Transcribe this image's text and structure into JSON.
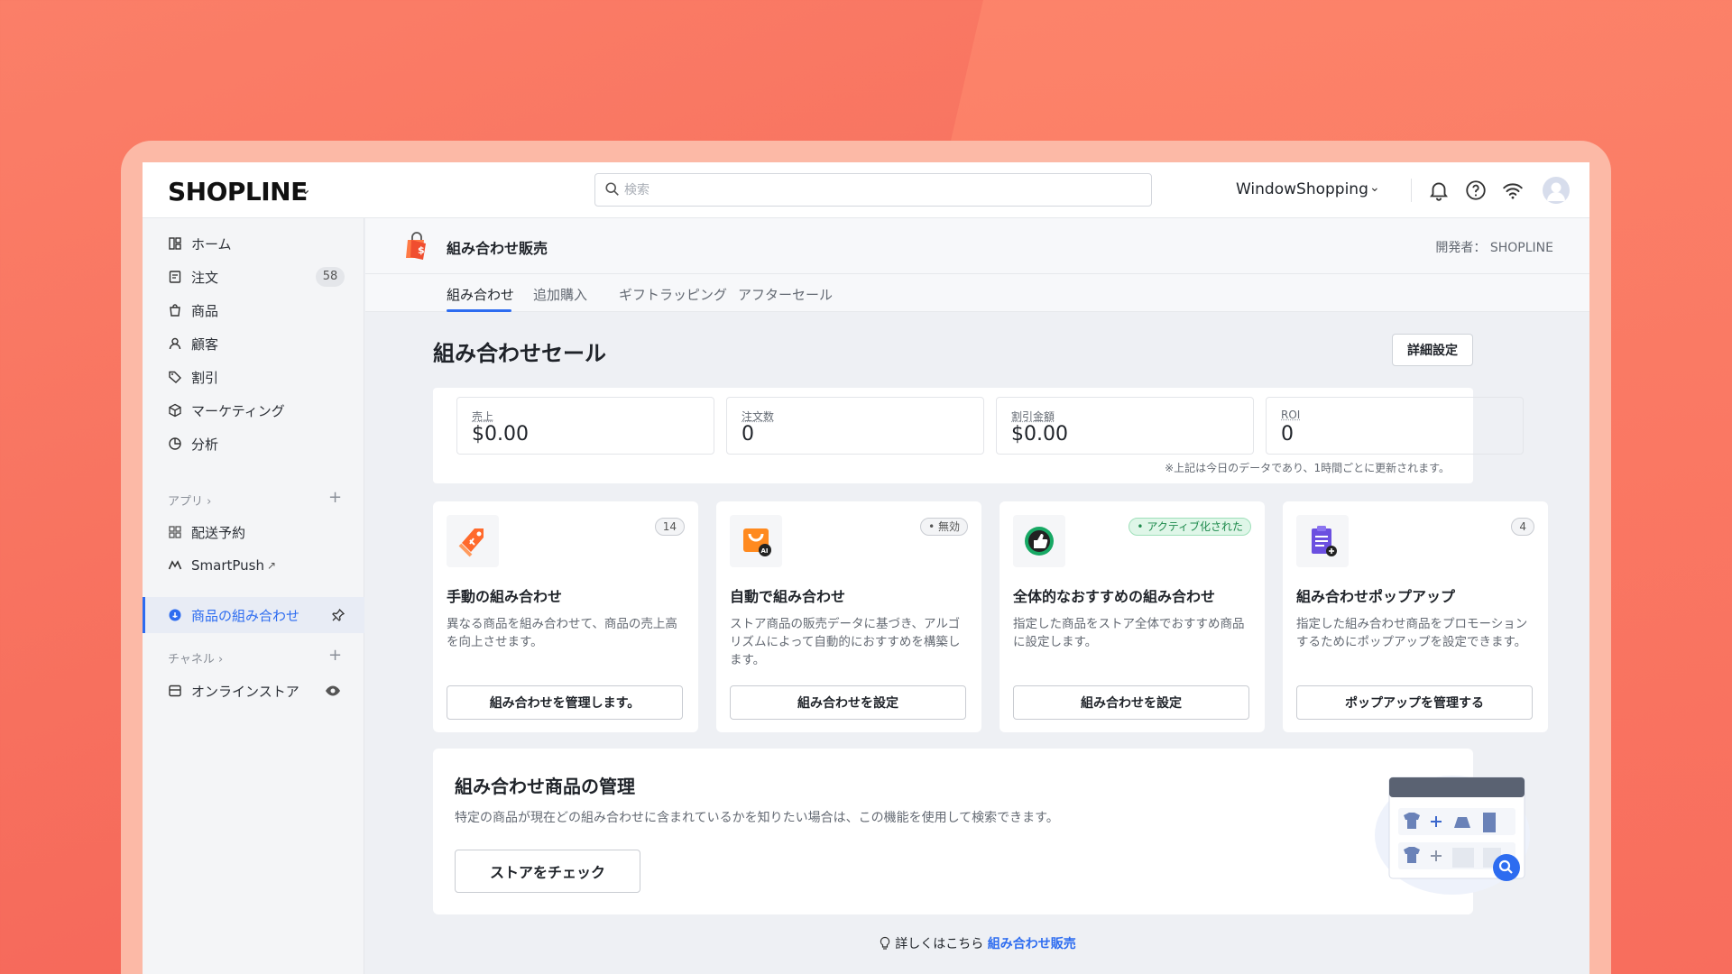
{
  "topbar": {
    "logo": "SHOPLINE",
    "search_placeholder": "検索",
    "store_name": "WindowShopping",
    "icons": [
      "bell-icon",
      "help-icon",
      "wifi-icon",
      "avatar"
    ]
  },
  "sidebar": {
    "items": [
      {
        "label": "ホーム",
        "icon": "home-icon"
      },
      {
        "label": "注文",
        "icon": "order-icon",
        "count": "58"
      },
      {
        "label": "商品",
        "icon": "bag-icon"
      },
      {
        "label": "顧客",
        "icon": "person-icon"
      },
      {
        "label": "割引",
        "icon": "tag-icon"
      },
      {
        "label": "マーケティング",
        "icon": "cube-icon"
      },
      {
        "label": "分析",
        "icon": "chart-icon"
      }
    ],
    "apps_label": "アプリ",
    "apps": [
      {
        "label": "配送予約",
        "icon": "grid-icon"
      },
      {
        "label": "SmartPush",
        "icon": "smartpush-icon"
      }
    ],
    "active_item": "商品の組み合わせ",
    "channels_label": "チャネル",
    "channels": [
      {
        "label": "オンラインストア",
        "icon": "store-icon"
      }
    ]
  },
  "app_header": {
    "title": "組み合わせ販売",
    "developer": "開発者： SHOPLINE"
  },
  "tabs": [
    "組み合わせ",
    "追加購入",
    "ギフトラッピング",
    "アフターセール"
  ],
  "main": {
    "title": "組み合わせセール",
    "settings_button": "詳細設定",
    "stats": [
      {
        "label": "売上",
        "value": "$0.00"
      },
      {
        "label": "注文数",
        "value": "0"
      },
      {
        "label": "割引金額",
        "value": "$0.00"
      },
      {
        "label": "ROI",
        "value": "0"
      }
    ],
    "stats_note": "※上記は今日のデータであり、1時間ごとに更新されます。",
    "cards": [
      {
        "title": "手動の組み合わせ",
        "badge": "14",
        "desc": "異なる商品を組み合わせて、商品の売上高を向上させます。",
        "button": "組み合わせを管理します。"
      },
      {
        "title": "自動で組み合わせ",
        "badge": "• 無効",
        "desc": "ストア商品の販売データに基づき、アルゴリズムによって自動的におすすめを構築します。",
        "button": "組み合わせを設定"
      },
      {
        "title": "全体的なおすすめの組み合わせ",
        "badge": "• アクティブ化された",
        "desc": "指定した商品をストア全体でおすすめ商品に設定します。",
        "button": "組み合わせを設定"
      },
      {
        "title": "組み合わせポップアップ",
        "badge": "4",
        "desc": "指定した組み合わせ商品をプロモーションするためにポップアップを設定できます。",
        "button": "ポップアップを管理する"
      }
    ],
    "manage": {
      "title": "組み合わせ商品の管理",
      "desc": "特定の商品が現在どの組み合わせに含まれているかを知りたい場合は、この機能を使用して検索できます。",
      "button": "ストアをチェック"
    },
    "footer": {
      "prefix": "詳しくはこちら",
      "link": "組み合わせ販売"
    }
  },
  "colors": {
    "accent": "#2d6cf0",
    "background": "#f7705e",
    "active_badge_bg": "#dff6e8",
    "active_badge_text": "#1e8a4c"
  }
}
